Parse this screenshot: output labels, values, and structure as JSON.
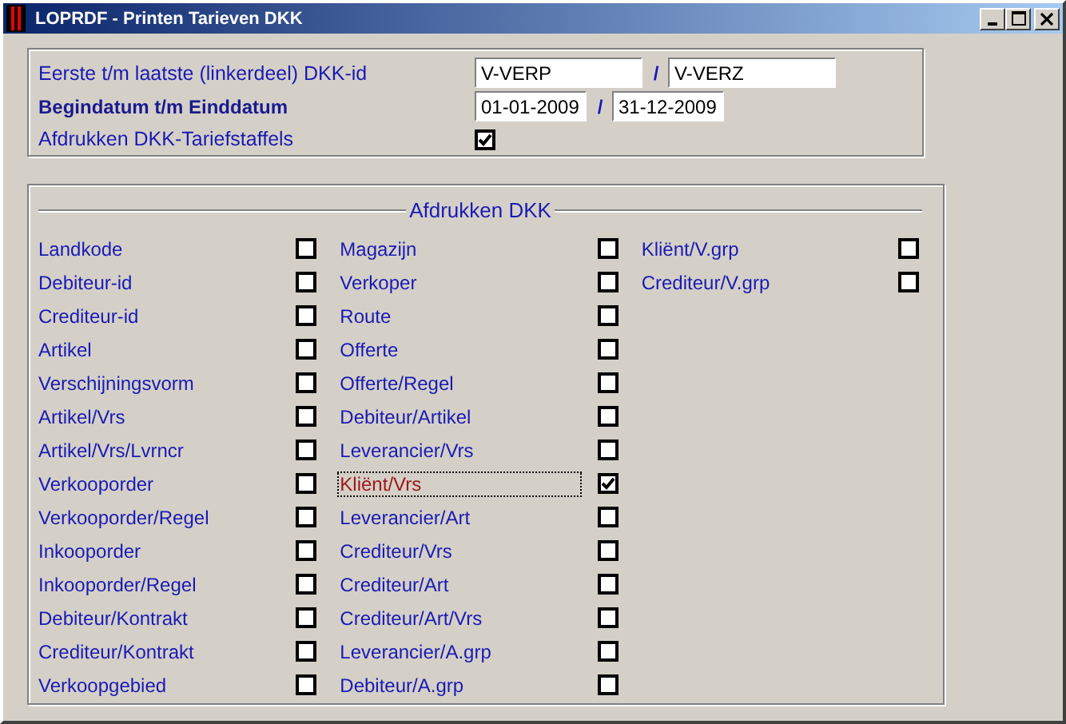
{
  "window": {
    "title": "LOPRDF - Printen Tarieven DKK"
  },
  "range_fields": [
    {
      "label": "Eerste t/m laatste (linkerdeel) DKK-id",
      "emphasized": false,
      "kind": "text",
      "from": "V-VERP",
      "separator": "/",
      "to": "V-VERZ"
    },
    {
      "label": "Begindatum t/m Einddatum",
      "emphasized": true,
      "kind": "date",
      "from": "01-01-2009",
      "separator": "/",
      "to": "31-12-2009"
    }
  ],
  "print_staffels": {
    "label": "Afdrukken DKK-Tariefstaffels",
    "checked": true
  },
  "print_group": {
    "title": "Afdrukken DKK",
    "columns": [
      [
        {
          "label": "Landkode",
          "checked": false,
          "focused": false
        },
        {
          "label": "Debiteur-id",
          "checked": false,
          "focused": false
        },
        {
          "label": "Crediteur-id",
          "checked": false,
          "focused": false
        },
        {
          "label": "Artikel",
          "checked": false,
          "focused": false
        },
        {
          "label": "Verschijningsvorm",
          "checked": false,
          "focused": false
        },
        {
          "label": "Artikel/Vrs",
          "checked": false,
          "focused": false
        },
        {
          "label": "Artikel/Vrs/Lvrncr",
          "checked": false,
          "focused": false
        },
        {
          "label": "Verkooporder",
          "checked": false,
          "focused": false
        },
        {
          "label": "Verkooporder/Regel",
          "checked": false,
          "focused": false
        },
        {
          "label": "Inkooporder",
          "checked": false,
          "focused": false
        },
        {
          "label": "Inkooporder/Regel",
          "checked": false,
          "focused": false
        },
        {
          "label": "Debiteur/Kontrakt",
          "checked": false,
          "focused": false
        },
        {
          "label": "Crediteur/Kontrakt",
          "checked": false,
          "focused": false
        },
        {
          "label": "Verkoopgebied",
          "checked": false,
          "focused": false
        }
      ],
      [
        {
          "label": "Magazijn",
          "checked": false,
          "focused": false
        },
        {
          "label": "Verkoper",
          "checked": false,
          "focused": false
        },
        {
          "label": "Route",
          "checked": false,
          "focused": false
        },
        {
          "label": "Offerte",
          "checked": false,
          "focused": false
        },
        {
          "label": "Offerte/Regel",
          "checked": false,
          "focused": false
        },
        {
          "label": "Debiteur/Artikel",
          "checked": false,
          "focused": false
        },
        {
          "label": "Leverancier/Vrs",
          "checked": false,
          "focused": false
        },
        {
          "label": "Kliënt/Vrs",
          "checked": true,
          "focused": true
        },
        {
          "label": "Leverancier/Art",
          "checked": false,
          "focused": false
        },
        {
          "label": "Crediteur/Vrs",
          "checked": false,
          "focused": false
        },
        {
          "label": "Crediteur/Art",
          "checked": false,
          "focused": false
        },
        {
          "label": "Crediteur/Art/Vrs",
          "checked": false,
          "focused": false
        },
        {
          "label": "Leverancier/A.grp",
          "checked": false,
          "focused": false
        },
        {
          "label": "Debiteur/A.grp",
          "checked": false,
          "focused": false
        }
      ],
      [
        {
          "label": "Kliënt/V.grp",
          "checked": false,
          "focused": false
        },
        {
          "label": "Crediteur/V.grp",
          "checked": false,
          "focused": false
        }
      ]
    ]
  }
}
